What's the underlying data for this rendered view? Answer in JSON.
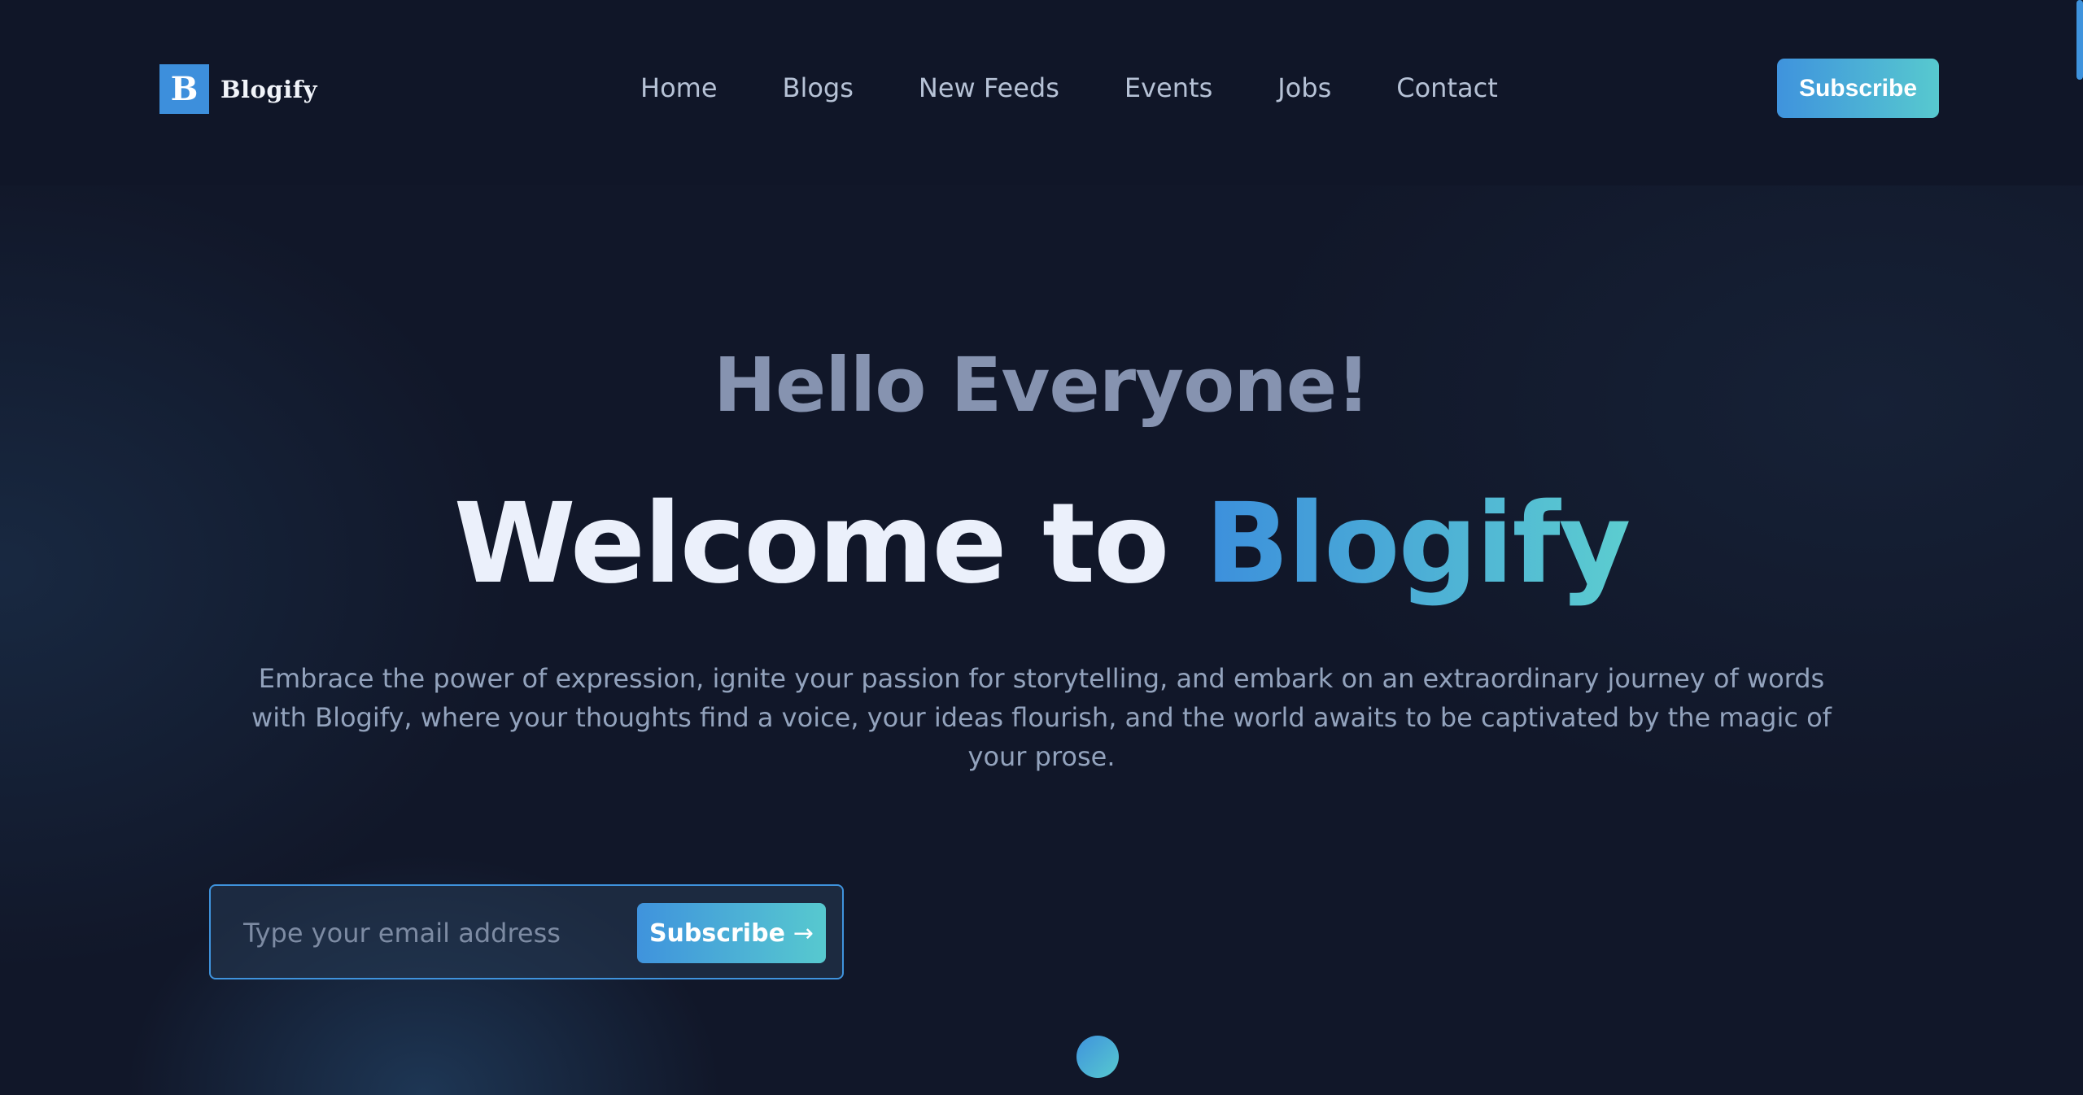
{
  "header": {
    "logo_letter": "B",
    "logo_text": "Blogify",
    "nav": [
      "Home",
      "Blogs",
      "New Feeds",
      "Events",
      "Jobs",
      "Contact"
    ],
    "subscribe_label": "Subscribe"
  },
  "hero": {
    "greeting": "Hello Everyone!",
    "welcome_prefix": "Welcome to ",
    "welcome_brand": "Blogify",
    "description": "Embrace the power of expression, ignite your passion for storytelling, and embark on an extraordinary journey of words with Blogify, where your thoughts find a voice, your ideas flourish, and the world awaits to be captivated by the magic of your prose."
  },
  "subscribe_form": {
    "email_placeholder": "Type your email address",
    "button_label": "Subscribe",
    "button_icon": "arrow-right-icon"
  },
  "colors": {
    "background": "#111729",
    "accent_start": "#3f93dd",
    "accent_end": "#57c9cf"
  }
}
